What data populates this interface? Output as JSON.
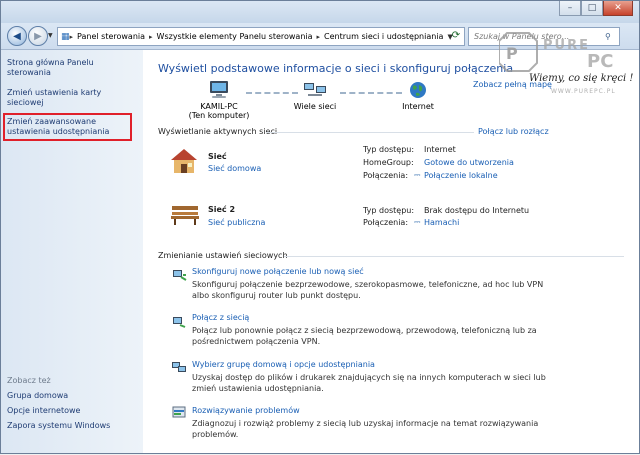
{
  "window": {
    "min_icon": "minimize-icon",
    "max_icon": "maximize-icon",
    "close_icon": "close-icon"
  },
  "address": {
    "back_icon": "back-arrow-icon",
    "forward_icon": "forward-arrow-icon",
    "segments": [
      "Panel sterowania",
      "Wszystkie elementy Panelu sterowania",
      "Centrum sieci i udostępniania"
    ],
    "search_placeholder": "Szukaj w Panelu stero..."
  },
  "sidebar": {
    "items": [
      "Strona główna Panelu sterowania",
      "Zmień ustawienia karty sieciowej",
      "Zmień zaawansowane ustawienia udostępniania"
    ],
    "see_also_header": "Zobacz też",
    "see_also": [
      "Grupa domowa",
      "Opcje internetowe",
      "Zapora systemu Windows"
    ]
  },
  "main": {
    "title": "Wyświetl podstawowe informacje o sieci i skonfiguruj połączenia",
    "full_map_link": "Zobacz pełną mapę",
    "map": {
      "computer_name": "KAMIL-PC",
      "computer_sub": "(Ten komputer)",
      "middle_label": "Wiele sieci",
      "internet_label": "Internet"
    },
    "active_header": "Wyświetlanie aktywnych sieci",
    "connect_disconnect": "Połącz lub rozłącz",
    "networks": [
      {
        "name": "Sieć",
        "type": "Sieć domowa",
        "access_key": "Typ dostępu:",
        "access_val": "Internet",
        "homegroup_key": "HomeGroup:",
        "homegroup_val": "Gotowe do utworzenia",
        "conn_key": "Połączenia:",
        "conn_val": "Połączenie lokalne"
      },
      {
        "name": "Sieć 2",
        "type": "Sieć publiczna",
        "access_key": "Typ dostępu:",
        "access_val": "Brak dostępu do Internetu",
        "conn_key": "Połączenia:",
        "conn_val": "Hamachi"
      }
    ],
    "change_header": "Zmienianie ustawień sieciowych",
    "tasks": [
      {
        "title": "Skonfiguruj nowe połączenie lub nową sieć",
        "desc": "Skonfiguruj połączenie bezprzewodowe, szerokopasmowe, telefoniczne, ad hoc lub VPN albo skonfiguruj router lub punkt dostępu."
      },
      {
        "title": "Połącz z siecią",
        "desc": "Połącz lub ponownie połącz z siecią bezprzewodową, przewodową, telefoniczną lub za pośrednictwem połączenia VPN."
      },
      {
        "title": "Wybierz grupę domową i opcje udostępniania",
        "desc": "Uzyskaj dostęp do plików i drukarek znajdujących się na innych komputerach w sieci lub zmień ustawienia udostępniania."
      },
      {
        "title": "Rozwiązywanie problemów",
        "desc": "Zdiagnozuj i rozwiąż problemy z siecią lub uzyskaj informacje na temat rozwiązywania problemów."
      }
    ]
  },
  "watermark": {
    "brand": "PURE PC",
    "slogan": "Wiemy, co się kręci !",
    "url": "WWW.PUREPC.PL"
  },
  "colors": {
    "link": "#1a5fb4",
    "title": "#1f4fa0",
    "highlight": "#e0202a"
  }
}
